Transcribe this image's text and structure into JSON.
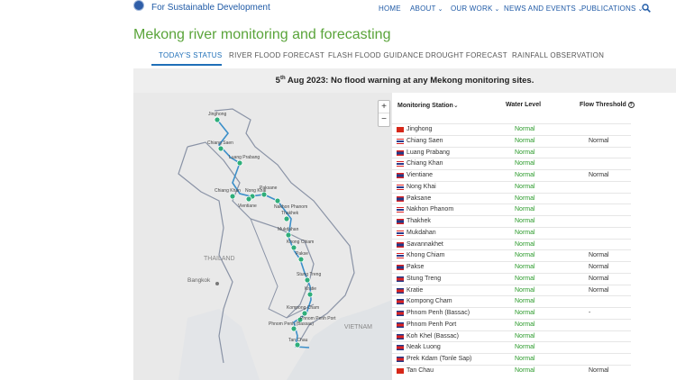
{
  "header": {
    "tagline": "For Sustainable Development",
    "nav": [
      {
        "label": "HOME",
        "dropdown": false
      },
      {
        "label": "ABOUT",
        "dropdown": true
      },
      {
        "label": "OUR WORK",
        "dropdown": true
      },
      {
        "label": "NEWS AND EVENTS",
        "dropdown": true
      },
      {
        "label": "PUBLICATIONS",
        "dropdown": true
      }
    ],
    "search_icon": "search-icon"
  },
  "page": {
    "title": "Mekong river monitoring and forecasting"
  },
  "tabs": [
    {
      "label": "TODAY'S STATUS",
      "active": true
    },
    {
      "label": "RIVER FLOOD FORECAST",
      "active": false
    },
    {
      "label": "FLASH FLOOD GUIDANCE",
      "active": false
    },
    {
      "label": "DROUGHT FORECAST",
      "active": false
    },
    {
      "label": "RAINFALL OBSERVATION",
      "active": false
    }
  ],
  "status": {
    "day": "5",
    "sup": "th",
    "rest": " Aug 2023",
    "message": ": No flood warning at any Mekong monitoring sites."
  },
  "map": {
    "zoom_in": "+",
    "zoom_out": "−",
    "regions": [
      "THAILAND",
      "VIETNAM"
    ],
    "cities": [
      "Bangkok"
    ],
    "stations": [
      "Jinghong",
      "Chiang Saen",
      "Luang Prabang",
      "Paksane",
      "Chiang Khan",
      "Nong Khai",
      "Vientiane",
      "Nakhon Phanom",
      "Thakhek",
      "Mukdahan",
      "Khong Chiam",
      "Pakse",
      "Stung Treng",
      "Kratie",
      "Kompong Cham",
      "Phnom Penh Port",
      "Phnom Penh (Bassac)",
      "Tan Chau"
    ]
  },
  "table": {
    "headers": {
      "station": "Monitoring Station",
      "water": "Water Level",
      "flow": "Flow Threshold"
    },
    "rows": [
      {
        "flag": "cn",
        "name": "Jinghong",
        "water": "Normal",
        "flow": ""
      },
      {
        "flag": "th",
        "name": "Chiang Saen",
        "water": "Normal",
        "flow": "Normal"
      },
      {
        "flag": "la",
        "name": "Luang Prabang",
        "water": "Normal",
        "flow": ""
      },
      {
        "flag": "th",
        "name": "Chiang Khan",
        "water": "Normal",
        "flow": ""
      },
      {
        "flag": "la",
        "name": "Vientiane",
        "water": "Normal",
        "flow": "Normal"
      },
      {
        "flag": "th",
        "name": "Nong Khai",
        "water": "Normal",
        "flow": ""
      },
      {
        "flag": "la",
        "name": "Paksane",
        "water": "Normal",
        "flow": ""
      },
      {
        "flag": "th",
        "name": "Nakhon Phanom",
        "water": "Normal",
        "flow": ""
      },
      {
        "flag": "la",
        "name": "Thakhek",
        "water": "Normal",
        "flow": ""
      },
      {
        "flag": "th",
        "name": "Mukdahan",
        "water": "Normal",
        "flow": ""
      },
      {
        "flag": "la",
        "name": "Savannakhet",
        "water": "Normal",
        "flow": ""
      },
      {
        "flag": "th",
        "name": "Khong Chiam",
        "water": "Normal",
        "flow": "Normal"
      },
      {
        "flag": "la",
        "name": "Pakse",
        "water": "Normal",
        "flow": "Normal"
      },
      {
        "flag": "kh",
        "name": "Stung Treng",
        "water": "Normal",
        "flow": "Normal"
      },
      {
        "flag": "kh",
        "name": "Kratie",
        "water": "Normal",
        "flow": "Normal"
      },
      {
        "flag": "kh",
        "name": "Kompong Cham",
        "water": "Normal",
        "flow": ""
      },
      {
        "flag": "kh",
        "name": "Phnom Penh (Bassac)",
        "water": "Normal",
        "flow": "-"
      },
      {
        "flag": "kh",
        "name": "Phnom Penh Port",
        "water": "Normal",
        "flow": ""
      },
      {
        "flag": "kh",
        "name": "Koh Khel (Bassac)",
        "water": "Normal",
        "flow": ""
      },
      {
        "flag": "kh",
        "name": "Neak Luong",
        "water": "Normal",
        "flow": ""
      },
      {
        "flag": "kh",
        "name": "Prek Kdam (Tonle Sap)",
        "water": "Normal",
        "flow": ""
      },
      {
        "flag": "vn",
        "name": "Tan Chau",
        "water": "Normal",
        "flow": "Normal"
      }
    ]
  },
  "colors": {
    "accent": "#1f6fb8",
    "title_green": "#5aa43a",
    "normal_green": "#2a9a2a",
    "station_marker": "#2fae7a"
  }
}
